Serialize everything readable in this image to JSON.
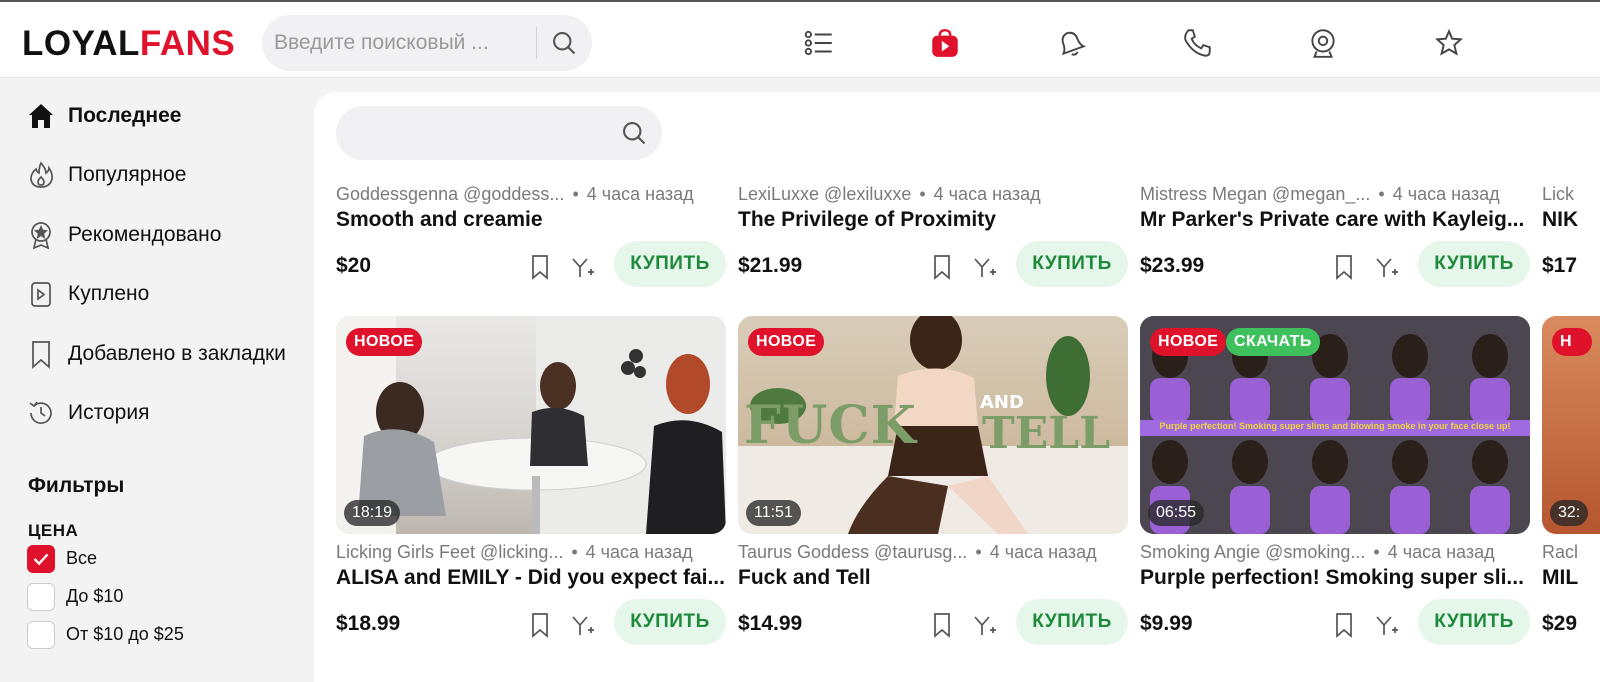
{
  "header": {
    "logo_part1": "LOYAL",
    "logo_part2": "FANS",
    "search_placeholder": "Введите поисковый ...",
    "nav_icons": [
      "list-icon",
      "video-bag-icon",
      "bell-icon",
      "phone-icon",
      "webcam-icon",
      "star-icon"
    ],
    "accent_color": "#e0112b"
  },
  "sidebar": {
    "items": [
      {
        "label": "Последнее",
        "icon": "home-icon",
        "active": true
      },
      {
        "label": "Популярное",
        "icon": "flame-icon",
        "active": false
      },
      {
        "label": "Рекомендовано",
        "icon": "award-icon",
        "active": false
      },
      {
        "label": "Куплено",
        "icon": "purchased-video-icon",
        "active": false
      },
      {
        "label": "Добавлено в закладки",
        "icon": "bookmark-icon",
        "active": false
      },
      {
        "label": "История",
        "icon": "history-icon",
        "active": false
      }
    ],
    "filters_title": "Фильтры",
    "price_label": "ЦЕНА",
    "price_options": [
      {
        "label": "Все",
        "checked": true
      },
      {
        "label": "До $10",
        "checked": false
      },
      {
        "label": "От $10 до $25",
        "checked": false
      }
    ]
  },
  "content": {
    "buy_label": "КУПИТЬ",
    "new_badge": "НОВОЕ",
    "download_badge": "СКАЧАТЬ",
    "row1": [
      {
        "author": "Goddessgenna @goddess...",
        "time": "4 часа назад",
        "title": "Smooth and creamie",
        "price": "$20"
      },
      {
        "author": "LexiLuxxe @lexiluxxe",
        "time": "4 часа назад",
        "title": "The Privilege of Proximity",
        "price": "$21.99"
      },
      {
        "author": "Mistress Megan @megan_...",
        "time": "4 часа назад",
        "title": "Mr Parker's Private care with Kayleig...",
        "price": "$23.99"
      },
      {
        "author": "Lick",
        "time": "",
        "title": "NIK",
        "price": "$17"
      }
    ],
    "row2": [
      {
        "author": "Licking Girls Feet @licking...",
        "time": "4 часа назад",
        "title": "ALISA and EMILY - Did you expect fai...",
        "price": "$18.99",
        "duration": "18:19",
        "download": false
      },
      {
        "author": "Taurus Goddess @taurusg...",
        "time": "4 часа назад",
        "title": "Fuck and Tell",
        "price": "$14.99",
        "duration": "11:51",
        "download": false
      },
      {
        "author": "Smoking Angie @smoking...",
        "time": "4 часа назад",
        "title": "Purple perfection! Smoking super sli...",
        "price": "$9.99",
        "duration": "06:55",
        "download": true
      },
      {
        "author": "Racl",
        "time": "",
        "title": "MIL",
        "price": "$29",
        "duration": "32:",
        "download": false
      }
    ],
    "thumb2_overlay": {
      "word1": "FUCK",
      "word2": "AND",
      "word3": "TELL"
    },
    "thumb3_overlay": "Purple perfection! Smoking super slims and blowing smoke in your face close up!"
  }
}
